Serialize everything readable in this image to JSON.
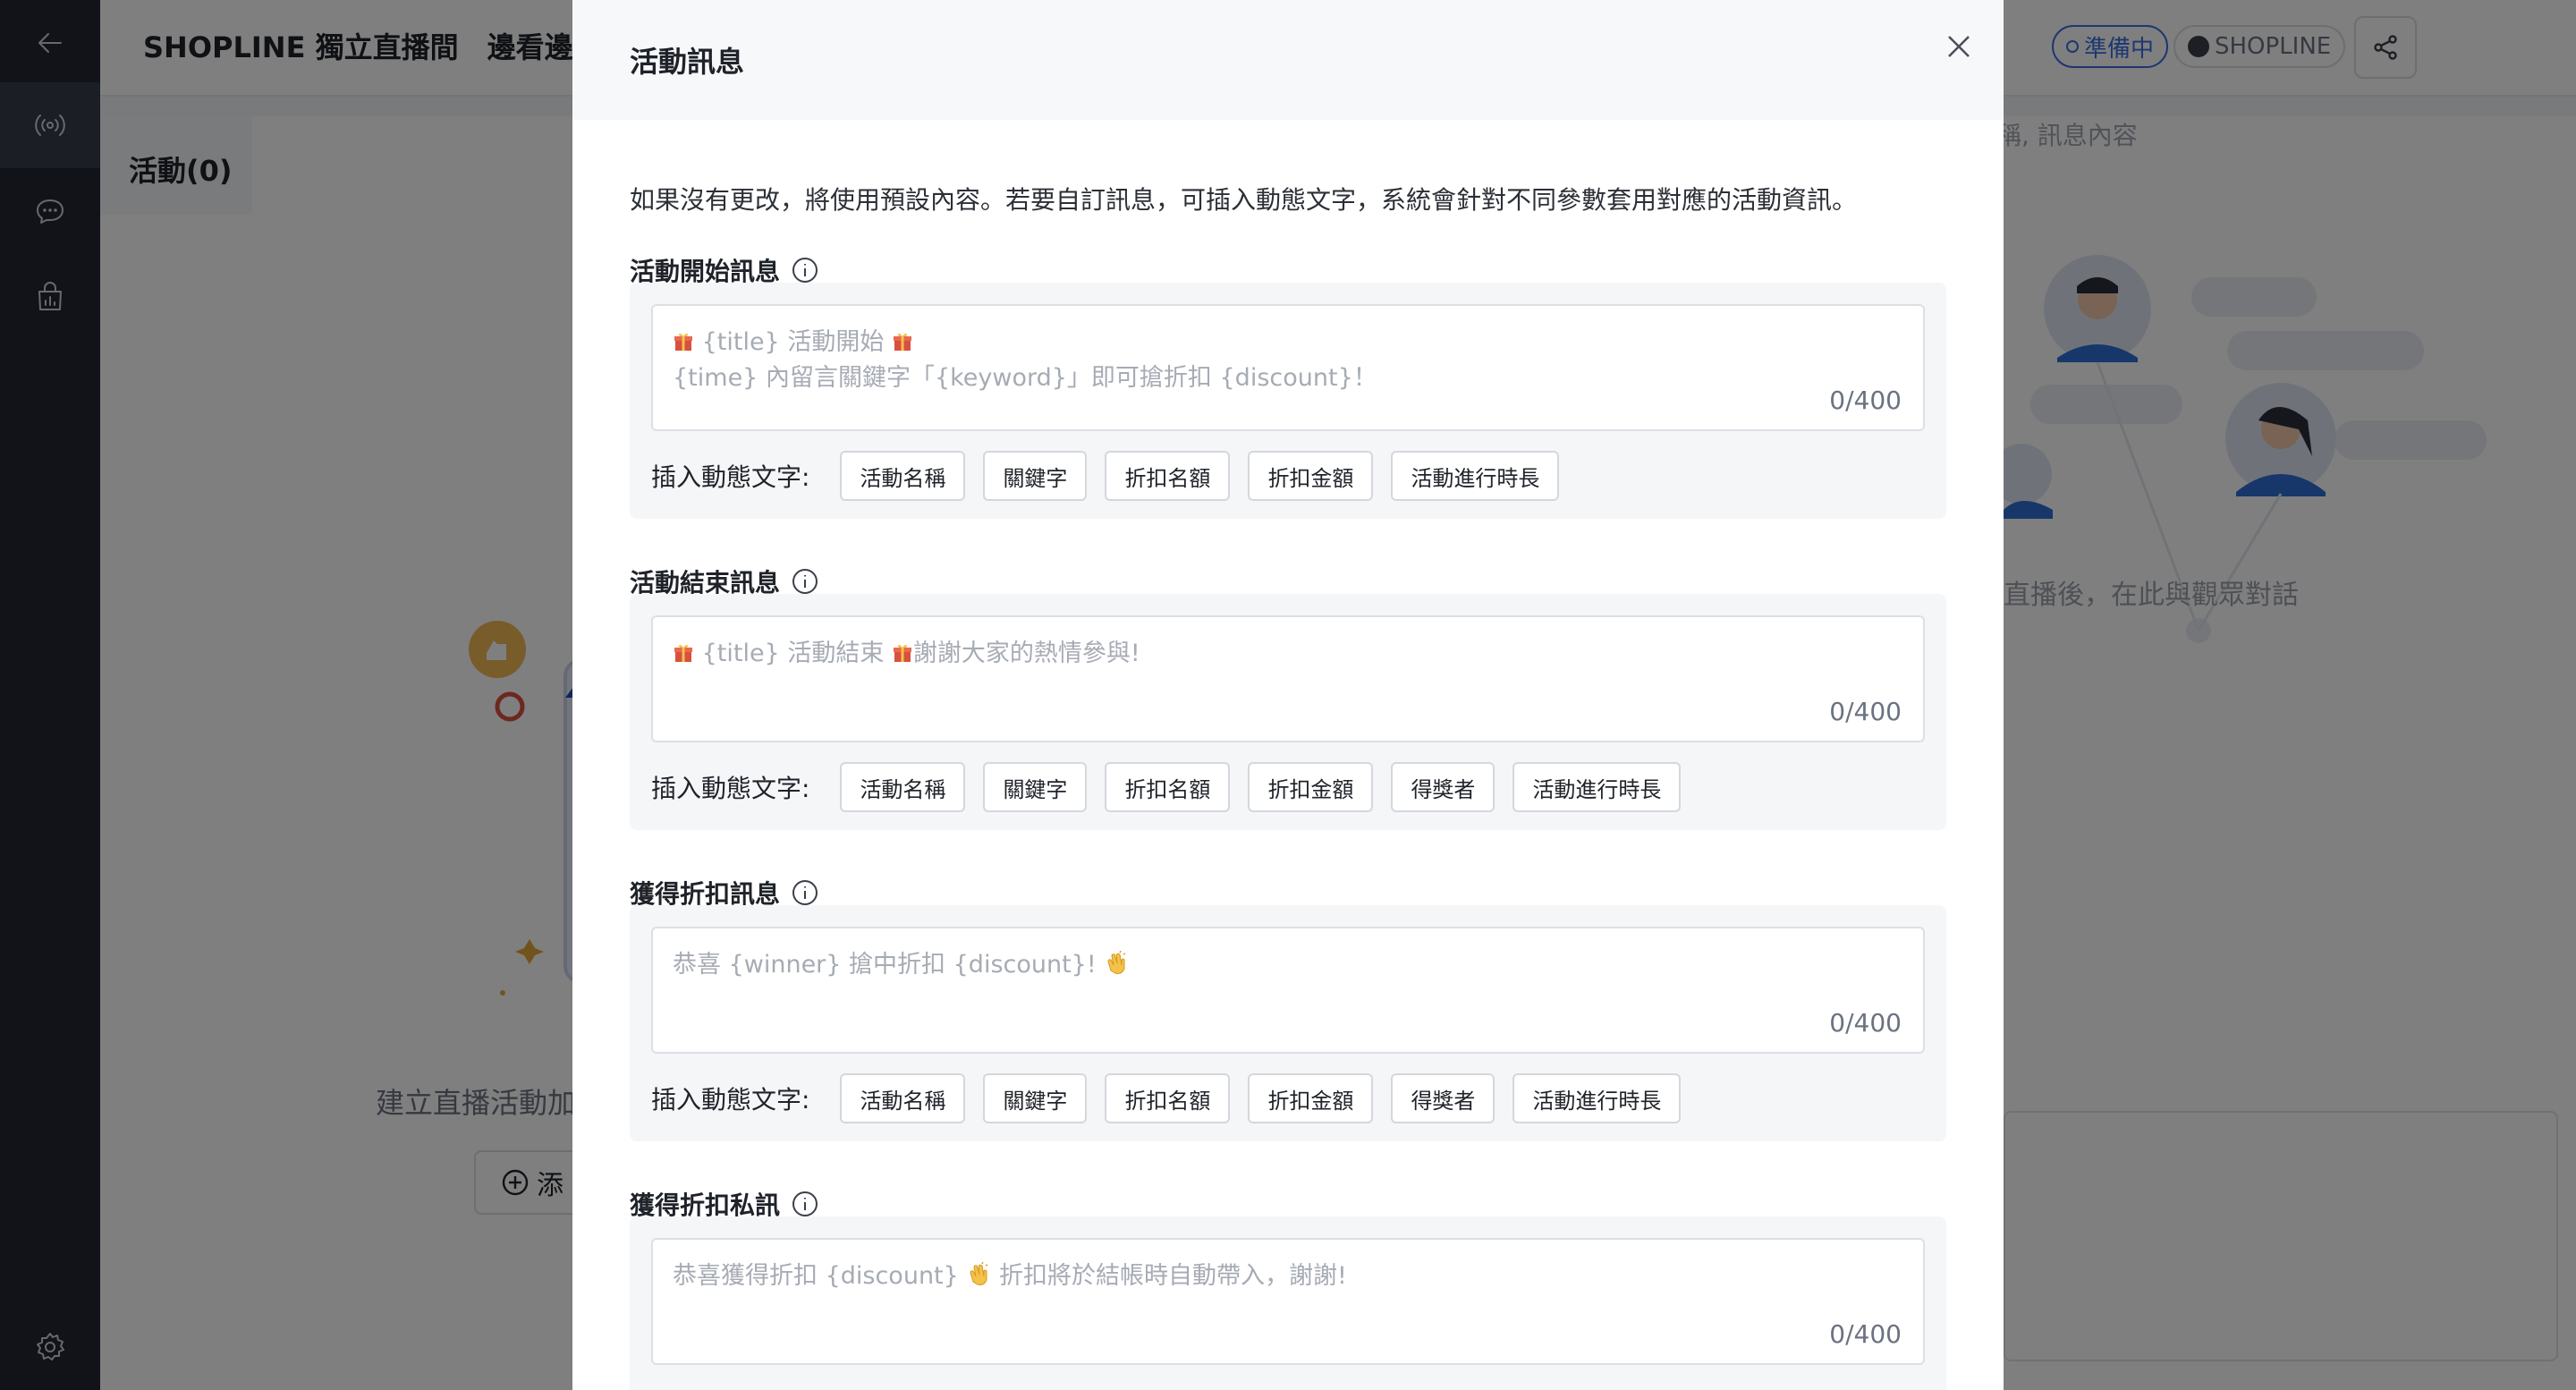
{
  "app": {
    "title": "SHOPLINE 獨立直播間　邊看邊買",
    "status": "準備中",
    "brand": "SHOPLINE"
  },
  "left": {
    "tab_label": "活動(0)",
    "empty_text": "建立直播活動加",
    "add_label": "添"
  },
  "right": {
    "search_placeholder": "稱, 訊息內容",
    "empty_text": "直播後，在此與觀眾對話"
  },
  "modal": {
    "title": "活動訊息",
    "description": "如果沒有更改，將使用預設內容。若要自訂訊息，可插入動態文字，系統會針對不同參數套用對應的活動資訊。",
    "insert_label": "插入動態文字:",
    "sections": [
      {
        "label": "活動開始訊息",
        "placeholder_line1": "{title} 活動開始",
        "placeholder_line2": "{time} 內留言關鍵字「{keyword}」即可搶折扣 {discount}！",
        "counter": "0/400",
        "chips": [
          "活動名稱",
          "關鍵字",
          "折扣名額",
          "折扣金額",
          "活動進行時長"
        ]
      },
      {
        "label": "活動結束訊息",
        "placeholder_part1": "{title} 活動結束",
        "placeholder_part2": "謝謝大家的熱情參與!",
        "counter": "0/400",
        "chips": [
          "活動名稱",
          "關鍵字",
          "折扣名額",
          "折扣金額",
          "得獎者",
          "活動進行時長"
        ]
      },
      {
        "label": "獲得折扣訊息",
        "placeholder_line1": "恭喜 {winner} 搶中折扣 {discount}!",
        "counter": "0/400",
        "chips": [
          "活動名稱",
          "關鍵字",
          "折扣名額",
          "折扣金額",
          "得獎者",
          "活動進行時長"
        ]
      },
      {
        "label": "獲得折扣私訊",
        "placeholder_part1": "恭喜獲得折扣 {discount}",
        "placeholder_part2": "折扣將於結帳時自動帶入，謝謝!",
        "counter": "0/400"
      }
    ]
  },
  "colors": {
    "accent": "#3b6ee0",
    "sidebar": "#232732",
    "overlay": "rgba(0,0,0,0.5)",
    "megaphone_red": "#c0392b",
    "gift_red": "#d9503f"
  },
  "icons": {
    "sidebar": [
      "back-arrow-icon",
      "broadcast-icon",
      "chat-bubble-icon",
      "analytics-bag-icon",
      "settings-gear-icon"
    ],
    "header": [
      "share-icon",
      "close-icon",
      "info-icon",
      "gift-icon",
      "clap-icon"
    ]
  }
}
